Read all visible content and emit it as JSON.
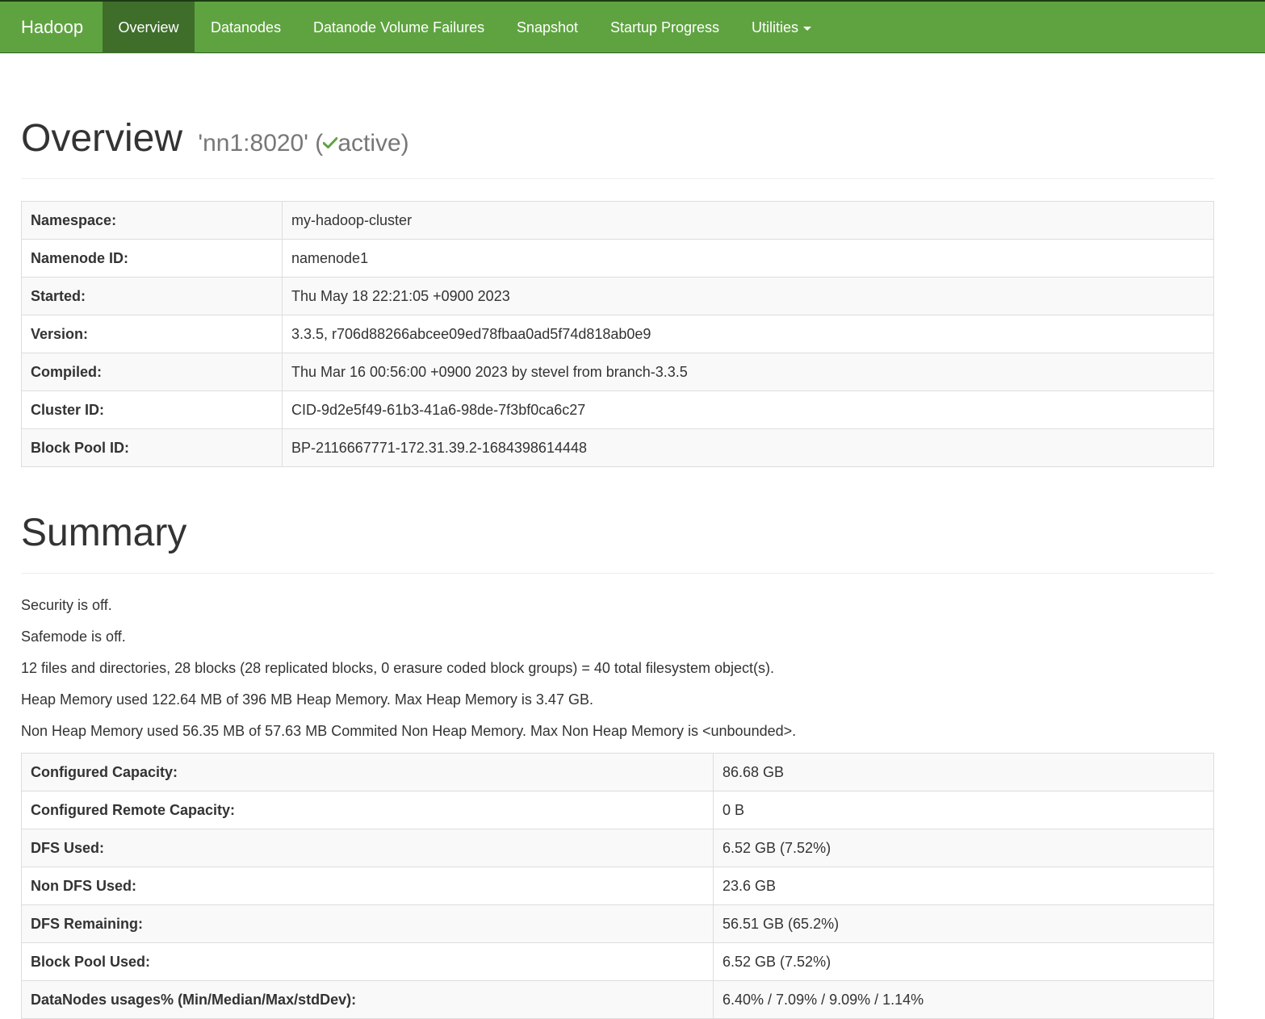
{
  "navbar": {
    "brand": "Hadoop",
    "items": [
      {
        "label": "Overview"
      },
      {
        "label": "Datanodes"
      },
      {
        "label": "Datanode Volume Failures"
      },
      {
        "label": "Snapshot"
      },
      {
        "label": "Startup Progress"
      },
      {
        "label": "Utilities"
      }
    ]
  },
  "overview": {
    "title": "Overview",
    "host": "'nn1:8020' (",
    "state": "active)",
    "rows": [
      {
        "key": "Namespace:",
        "value": "my-hadoop-cluster"
      },
      {
        "key": "Namenode ID:",
        "value": "namenode1"
      },
      {
        "key": "Started:",
        "value": "Thu May 18 22:21:05 +0900 2023"
      },
      {
        "key": "Version:",
        "value": "3.3.5, r706d88266abcee09ed78fbaa0ad5f74d818ab0e9"
      },
      {
        "key": "Compiled:",
        "value": "Thu Mar 16 00:56:00 +0900 2023 by stevel from branch-3.3.5"
      },
      {
        "key": "Cluster ID:",
        "value": "CID-9d2e5f49-61b3-41a6-98de-7f3bf0ca6c27"
      },
      {
        "key": "Block Pool ID:",
        "value": "BP-2116667771-172.31.39.2-1684398614448"
      }
    ]
  },
  "summary": {
    "title": "Summary",
    "lines": [
      "Security is off.",
      "Safemode is off.",
      "12 files and directories, 28 blocks (28 replicated blocks, 0 erasure coded block groups) = 40 total filesystem object(s).",
      "Heap Memory used 122.64 MB of 396 MB Heap Memory. Max Heap Memory is 3.47 GB.",
      "Non Heap Memory used 56.35 MB of 57.63 MB Commited Non Heap Memory. Max Non Heap Memory is <unbounded>."
    ],
    "rows": [
      {
        "key": "Configured Capacity:",
        "value": "86.68 GB"
      },
      {
        "key": "Configured Remote Capacity:",
        "value": "0 B"
      },
      {
        "key": "DFS Used:",
        "value": "6.52 GB (7.52%)"
      },
      {
        "key": "Non DFS Used:",
        "value": "23.6 GB"
      },
      {
        "key": "DFS Remaining:",
        "value": "56.51 GB (65.2%)"
      },
      {
        "key": "Block Pool Used:",
        "value": "6.52 GB (7.52%)"
      },
      {
        "key": "DataNodes usages% (Min/Median/Max/stdDev):",
        "value": "6.40% / 7.09% / 9.09% / 1.14%"
      }
    ]
  },
  "colors": {
    "navbar": "#5fa341",
    "navbar_active": "#3f6e2b",
    "check": "#5fa341"
  }
}
